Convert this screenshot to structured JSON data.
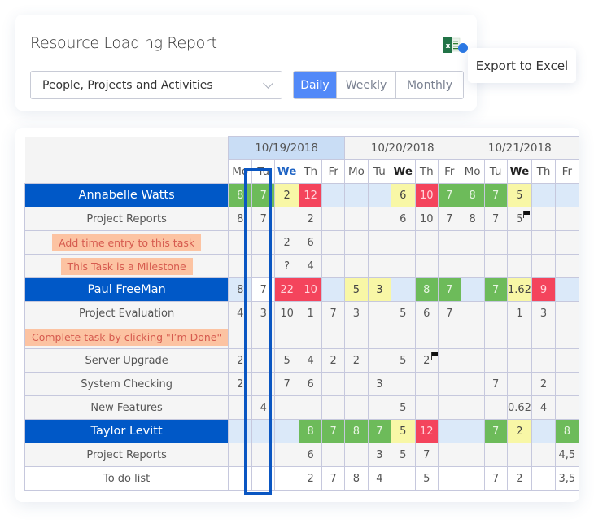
{
  "header": {
    "title": "Resource Loading Report",
    "export_icon": "excel-icon",
    "export_tooltip": "Export to Excel",
    "view_select": {
      "value": "People, Projects and Activities"
    },
    "period_tabs": [
      {
        "label": "Daily",
        "active": true
      },
      {
        "label": "Weekly",
        "active": false
      },
      {
        "label": "Monthly",
        "active": false
      }
    ]
  },
  "grid": {
    "dates": [
      {
        "label": "10/19/2018",
        "current": true
      },
      {
        "label": "10/20/2018",
        "current": false
      },
      {
        "label": "10/21/2018",
        "current": false
      }
    ],
    "days": [
      "Mo",
      "Tu",
      "We",
      "Th",
      "Fr",
      "Mo",
      "Tu",
      "We",
      "Th",
      "Fr",
      "Mo",
      "Tu",
      "We",
      "Th",
      "Fr"
    ],
    "current_day_index": 2,
    "bold_day_indices": [
      7,
      12
    ],
    "colors": {
      "over": "#f4445c",
      "full": "#6dbb5a",
      "under": "#f8f7a6",
      "empty": "#dbe9f9",
      "person_row": "#0058c7",
      "hint_bg": "#fcc3a2"
    },
    "rows": [
      {
        "type": "person",
        "name": "Annabelle Watts",
        "cells": [
          "8",
          "7",
          "2",
          "12",
          "",
          "",
          "",
          "6",
          "10",
          "7",
          "8",
          "7",
          "5",
          "",
          ""
        ],
        "status": [
          "full",
          "full",
          "under",
          "over",
          "empty",
          "empty",
          "empty",
          "under",
          "over",
          "full",
          "full",
          "full",
          "under",
          "empty",
          "empty"
        ]
      },
      {
        "type": "task",
        "name": "Project Reports",
        "cells": [
          "8",
          "7",
          "",
          "2",
          "",
          "",
          "",
          "6",
          "10",
          "7",
          "8",
          "7",
          "5",
          "",
          ""
        ],
        "flags": [
          12
        ]
      },
      {
        "type": "hint",
        "name": "Add time entry to this task",
        "cells": [
          "",
          "",
          "2",
          "6",
          "",
          "",
          "",
          "",
          "",
          "",
          "",
          "",
          "",
          "",
          ""
        ]
      },
      {
        "type": "hint",
        "name": "This Task is a Milestone",
        "cells": [
          "",
          "",
          "?",
          "4",
          "",
          "",
          "",
          "",
          "",
          "",
          "",
          "",
          "",
          "",
          ""
        ]
      },
      {
        "type": "person",
        "name": "Paul FreeMan",
        "cells": [
          "8",
          "7",
          "22",
          "10",
          "",
          "5",
          "3",
          "",
          "8",
          "7",
          "",
          "7",
          "1.62",
          "9",
          ""
        ],
        "status": [
          "empty",
          "white",
          "over",
          "over",
          "empty",
          "under",
          "under",
          "empty",
          "full",
          "full",
          "empty",
          "full",
          "under",
          "over",
          "empty"
        ]
      },
      {
        "type": "task",
        "name": "Project Evaluation",
        "cells": [
          "4",
          "3",
          "10",
          "1",
          "7",
          "3",
          "",
          "5",
          "6",
          "7",
          "",
          "",
          "1",
          "3",
          ""
        ]
      },
      {
        "type": "hint",
        "name": "Complete task by clicking \"I’m Done\"",
        "cells": [
          "",
          "",
          "",
          "",
          "",
          "",
          "",
          "",
          "",
          "",
          "",
          "",
          "",
          "",
          ""
        ]
      },
      {
        "type": "task",
        "name": "Server Upgrade",
        "cells": [
          "2",
          "",
          "5",
          "4",
          "2",
          "2",
          "",
          "5",
          "2",
          "",
          "",
          "",
          "",
          "",
          ""
        ],
        "flags": [
          8
        ]
      },
      {
        "type": "task",
        "name": "System Checking",
        "cells": [
          "2",
          "",
          "7",
          "6",
          "",
          "",
          "3",
          "",
          "",
          "",
          "",
          "7",
          "",
          "2",
          ""
        ]
      },
      {
        "type": "task",
        "name": "New Features",
        "cells": [
          "",
          "4",
          "",
          "",
          "",
          "",
          "",
          "5",
          "",
          "",
          "",
          "",
          "0.62",
          "4",
          ""
        ]
      },
      {
        "type": "person",
        "name": "Taylor Levitt",
        "cells": [
          "",
          "",
          "",
          "8",
          "7",
          "8",
          "7",
          "5",
          "12",
          "",
          "",
          "7",
          "2",
          "",
          "8"
        ],
        "status": [
          "empty",
          "empty",
          "empty",
          "full",
          "full",
          "full",
          "full",
          "under",
          "over",
          "empty",
          "empty",
          "full",
          "under",
          "empty",
          "full"
        ]
      },
      {
        "type": "task",
        "name": "Project Reports",
        "cells": [
          "",
          "",
          "",
          "6",
          "",
          "",
          "3",
          "5",
          "7",
          "",
          "",
          "",
          "",
          "",
          "4,5"
        ]
      },
      {
        "type": "task-white",
        "name": "To do list",
        "cells": [
          "",
          "",
          "",
          "2",
          "7",
          "8",
          "4",
          "",
          "5",
          "",
          "",
          "7",
          "2",
          "",
          "3,5"
        ]
      }
    ]
  }
}
